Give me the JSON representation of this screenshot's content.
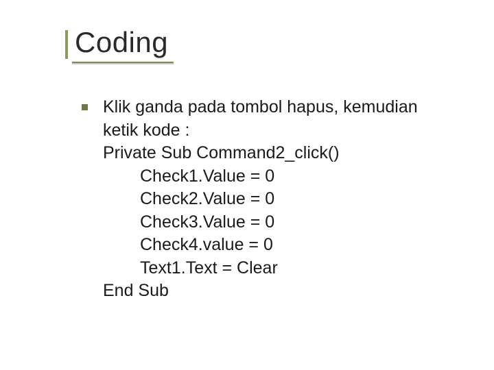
{
  "title": "Coding",
  "bullet": {
    "intro_line1": "Klik ganda pada tombol hapus, kemudian",
    "intro_line2": "ketik kode :",
    "code_line1": "Private Sub Command2_click()",
    "code_line2": "Check1.Value = 0",
    "code_line3": "Check2.Value = 0",
    "code_line4": "Check3.Value = 0",
    "code_line5": "Check4.value = 0",
    "code_line6": "Text1.Text = Clear",
    "code_line7": "End Sub"
  }
}
